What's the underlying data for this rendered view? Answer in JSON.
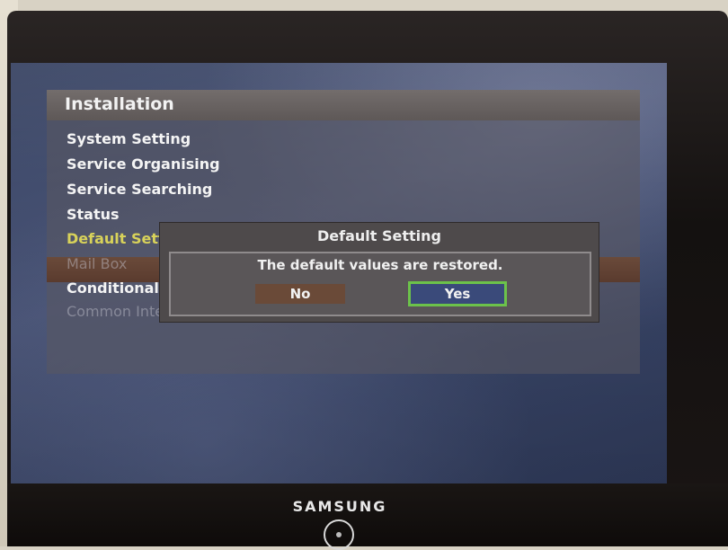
{
  "menu": {
    "title": "Installation",
    "items": [
      {
        "label": "System Setting"
      },
      {
        "label": "Service Organising"
      },
      {
        "label": "Service Searching"
      },
      {
        "label": "Status"
      },
      {
        "label": "Default Setting"
      },
      {
        "label": "Mail Box"
      },
      {
        "label": "Conditional Access"
      },
      {
        "label": "Common Interface"
      }
    ],
    "selected_index": 4
  },
  "dialog": {
    "title": "Default Setting",
    "message": "The default values are restored.",
    "no_label": "No",
    "yes_label": "Yes",
    "focused": "Yes"
  },
  "tv": {
    "brand": "SAMSUNG"
  },
  "colors": {
    "selected_text": "#d8d25a",
    "focus_border": "#6cc24a",
    "menu_highlight": "#5a3b2e"
  },
  "icons": [
    "power-button-icon"
  ]
}
